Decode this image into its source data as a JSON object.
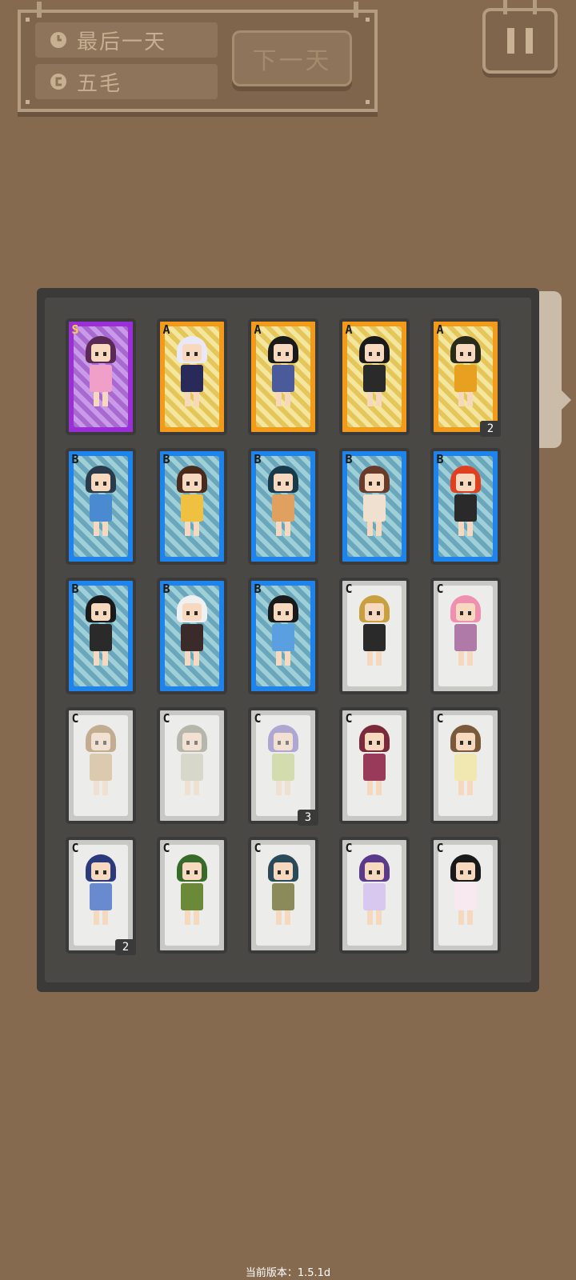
{
  "hud": {
    "day_label": "最后一天",
    "money_label": "五毛",
    "next_day_button": "下一天",
    "day_icon": "clock-icon",
    "money_icon": "coin-icon",
    "pause_icon": "pause-icon"
  },
  "cards": [
    {
      "rank": "S",
      "hair": "#5a2a55",
      "outfit": "#f0a0c8",
      "faded": false
    },
    {
      "rank": "A",
      "hair": "#e8e8f8",
      "outfit": "#2a2a5a",
      "faded": false
    },
    {
      "rank": "A",
      "hair": "#1a1a1a",
      "outfit": "#4a5a9a",
      "faded": false
    },
    {
      "rank": "A",
      "hair": "#1a1a1a",
      "outfit": "#2a2a2a",
      "faded": false
    },
    {
      "rank": "A",
      "hair": "#2a2a1a",
      "outfit": "#e8a020",
      "faded": false,
      "count": "2"
    },
    {
      "rank": "B",
      "hair": "#2a3a4a",
      "outfit": "#4a8ad0",
      "faded": false
    },
    {
      "rank": "B",
      "hair": "#4a2a1a",
      "outfit": "#f0c040",
      "faded": false
    },
    {
      "rank": "B",
      "hair": "#1a3a4a",
      "outfit": "#e0a060",
      "faded": false
    },
    {
      "rank": "B",
      "hair": "#6a3a2a",
      "outfit": "#f0e0d0",
      "faded": false
    },
    {
      "rank": "B",
      "hair": "#e04020",
      "outfit": "#2a2a2a",
      "faded": false
    },
    {
      "rank": "B",
      "hair": "#1a1a1a",
      "outfit": "#2a2a2a",
      "faded": false
    },
    {
      "rank": "B",
      "hair": "#f0f0f0",
      "outfit": "#3a2a2a",
      "faded": false
    },
    {
      "rank": "B",
      "hair": "#1a1a1a",
      "outfit": "#5aa0e0",
      "faded": false
    },
    {
      "rank": "C",
      "hair": "#c8a040",
      "outfit": "#2a2a2a",
      "faded": false
    },
    {
      "rank": "C",
      "hair": "#f090b0",
      "outfit": "#b07aa8",
      "faded": false
    },
    {
      "rank": "C",
      "hair": "#a07a4a",
      "outfit": "#d0b080",
      "faded": true
    },
    {
      "rank": "C",
      "hair": "#8a8a7a",
      "outfit": "#c8c8b0",
      "faded": true
    },
    {
      "rank": "C",
      "hair": "#7a70c0",
      "outfit": "#c0d080",
      "faded": true,
      "count": "3"
    },
    {
      "rank": "C",
      "hair": "#7a2a3a",
      "outfit": "#9a3a5a",
      "faded": false
    },
    {
      "rank": "C",
      "hair": "#7a5a3a",
      "outfit": "#f0e8b0",
      "faded": false
    },
    {
      "rank": "C",
      "hair": "#2a3a7a",
      "outfit": "#6a8ad0",
      "faded": false,
      "count": "2"
    },
    {
      "rank": "C",
      "hair": "#3a6a2a",
      "outfit": "#6a8a3a",
      "faded": false
    },
    {
      "rank": "C",
      "hair": "#2a4a5a",
      "outfit": "#8a8a5a",
      "faded": false
    },
    {
      "rank": "C",
      "hair": "#5a3a8a",
      "outfit": "#d8c8f0",
      "faded": false
    },
    {
      "rank": "C",
      "hair": "#1a1a1a",
      "outfit": "#f8e8f0",
      "faded": false
    }
  ],
  "footer": {
    "version": "当前版本：1.5.1d"
  }
}
